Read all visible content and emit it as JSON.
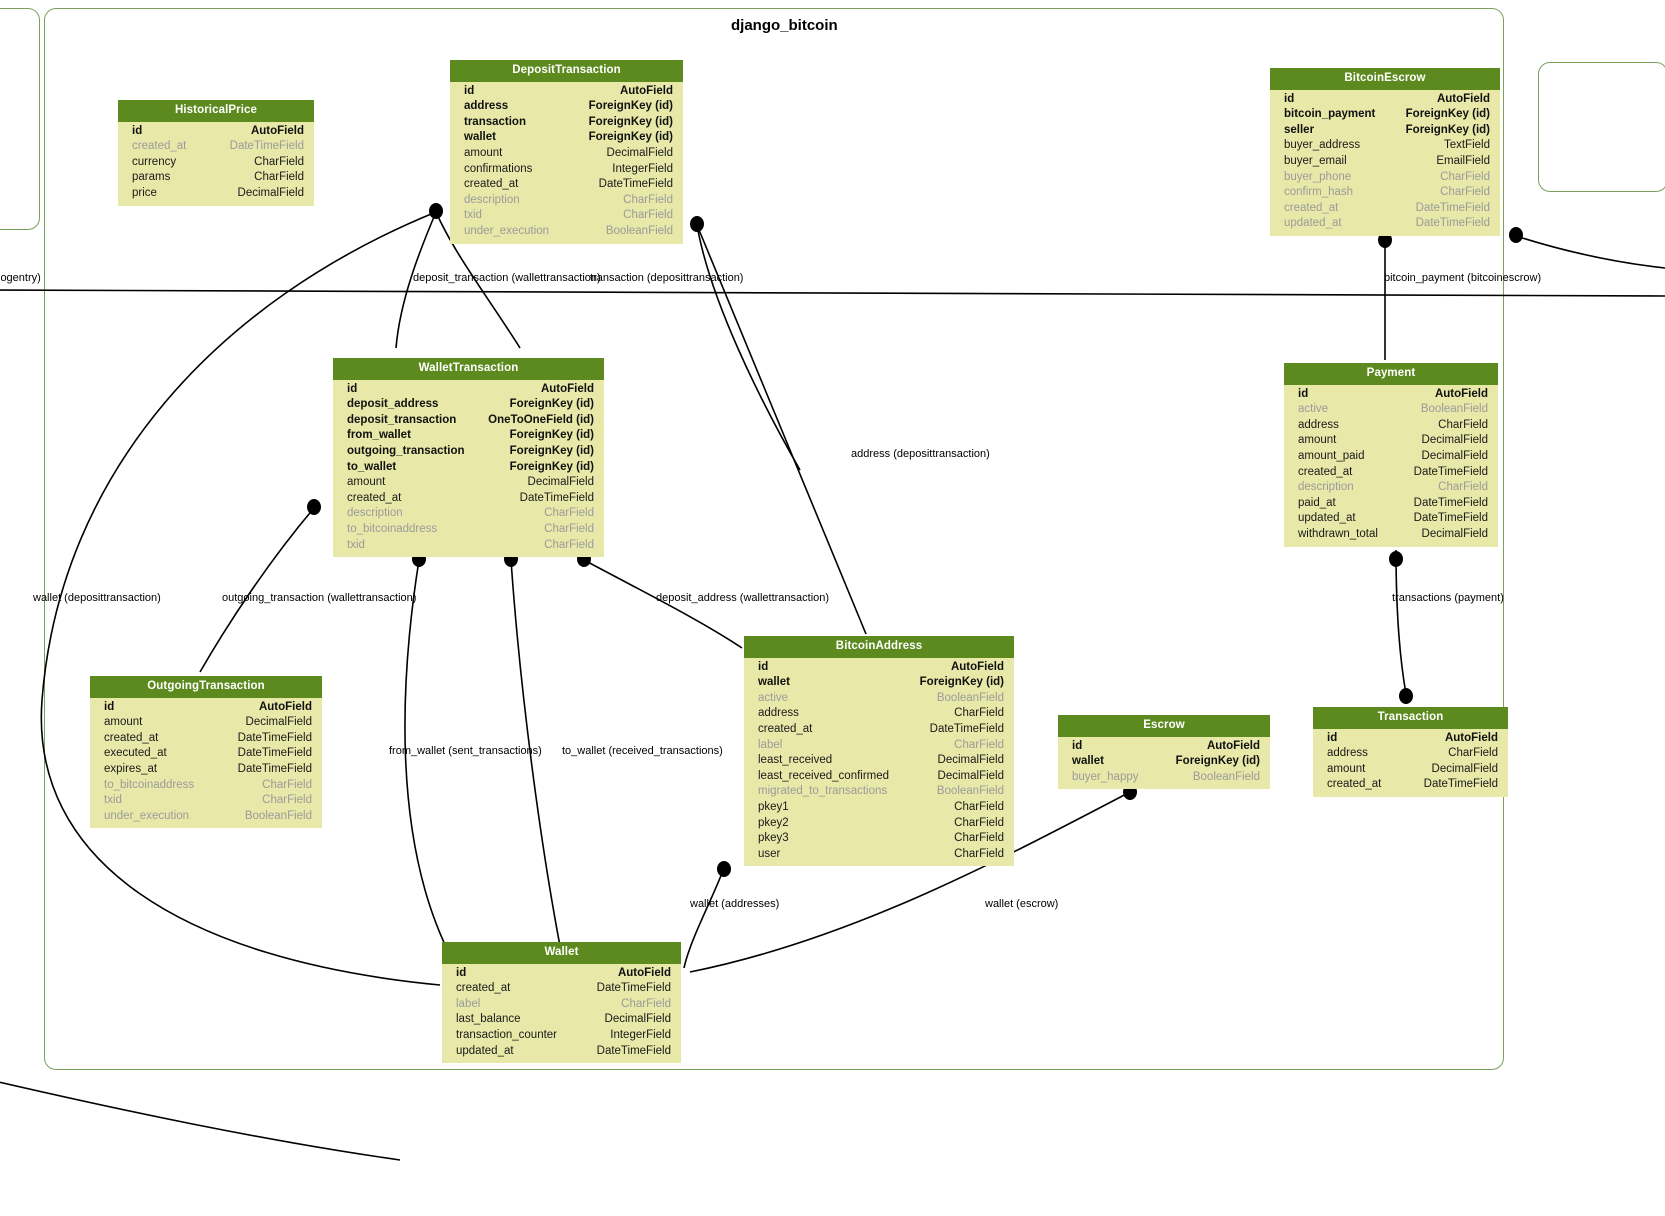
{
  "diagram": {
    "title": "django_bitcoin",
    "header_color": "#5c8a1e",
    "body_color": "#e8e8a8",
    "cluster_border_color": "#7ba05b"
  },
  "clusters": [
    {
      "name": "django_bitcoin",
      "title": "django_bitcoin"
    },
    {
      "name": "left-partial-cluster",
      "title": ""
    },
    {
      "name": "right-partial-cluster",
      "title": ""
    }
  ],
  "entities": [
    {
      "name": "HistoricalPrice",
      "title": "HistoricalPrice",
      "fields": [
        {
          "name": "id",
          "type": "AutoField",
          "style": "req"
        },
        {
          "name": "created_at",
          "type": "DateTimeField",
          "style": "dim"
        },
        {
          "name": "currency",
          "type": "CharField",
          "style": "norm"
        },
        {
          "name": "params",
          "type": "CharField",
          "style": "norm"
        },
        {
          "name": "price",
          "type": "DecimalField",
          "style": "norm"
        }
      ]
    },
    {
      "name": "DepositTransaction",
      "title": "DepositTransaction",
      "fields": [
        {
          "name": "id",
          "type": "AutoField",
          "style": "req"
        },
        {
          "name": "address",
          "type": "ForeignKey (id)",
          "style": "req"
        },
        {
          "name": "transaction",
          "type": "ForeignKey (id)",
          "style": "req"
        },
        {
          "name": "wallet",
          "type": "ForeignKey (id)",
          "style": "req"
        },
        {
          "name": "amount",
          "type": "DecimalField",
          "style": "norm"
        },
        {
          "name": "confirmations",
          "type": "IntegerField",
          "style": "norm"
        },
        {
          "name": "created_at",
          "type": "DateTimeField",
          "style": "norm"
        },
        {
          "name": "description",
          "type": "CharField",
          "style": "dim"
        },
        {
          "name": "txid",
          "type": "CharField",
          "style": "dim"
        },
        {
          "name": "under_execution",
          "type": "BooleanField",
          "style": "dim"
        }
      ]
    },
    {
      "name": "BitcoinEscrow",
      "title": "BitcoinEscrow",
      "fields": [
        {
          "name": "id",
          "type": "AutoField",
          "style": "req"
        },
        {
          "name": "bitcoin_payment",
          "type": "ForeignKey (id)",
          "style": "req"
        },
        {
          "name": "seller",
          "type": "ForeignKey (id)",
          "style": "req"
        },
        {
          "name": "buyer_address",
          "type": "TextField",
          "style": "norm"
        },
        {
          "name": "buyer_email",
          "type": "EmailField",
          "style": "norm"
        },
        {
          "name": "buyer_phone",
          "type": "CharField",
          "style": "dim"
        },
        {
          "name": "confirm_hash",
          "type": "CharField",
          "style": "dim"
        },
        {
          "name": "created_at",
          "type": "DateTimeField",
          "style": "dim"
        },
        {
          "name": "updated_at",
          "type": "DateTimeField",
          "style": "dim"
        }
      ]
    },
    {
      "name": "WalletTransaction",
      "title": "WalletTransaction",
      "fields": [
        {
          "name": "id",
          "type": "AutoField",
          "style": "req"
        },
        {
          "name": "deposit_address",
          "type": "ForeignKey (id)",
          "style": "req"
        },
        {
          "name": "deposit_transaction",
          "type": "OneToOneField (id)",
          "style": "req"
        },
        {
          "name": "from_wallet",
          "type": "ForeignKey (id)",
          "style": "req"
        },
        {
          "name": "outgoing_transaction",
          "type": "ForeignKey (id)",
          "style": "req"
        },
        {
          "name": "to_wallet",
          "type": "ForeignKey (id)",
          "style": "req"
        },
        {
          "name": "amount",
          "type": "DecimalField",
          "style": "norm"
        },
        {
          "name": "created_at",
          "type": "DateTimeField",
          "style": "norm"
        },
        {
          "name": "description",
          "type": "CharField",
          "style": "dim"
        },
        {
          "name": "to_bitcoinaddress",
          "type": "CharField",
          "style": "dim"
        },
        {
          "name": "txid",
          "type": "CharField",
          "style": "dim"
        }
      ]
    },
    {
      "name": "Payment",
      "title": "Payment",
      "fields": [
        {
          "name": "id",
          "type": "AutoField",
          "style": "req"
        },
        {
          "name": "active",
          "type": "BooleanField",
          "style": "dim"
        },
        {
          "name": "address",
          "type": "CharField",
          "style": "norm"
        },
        {
          "name": "amount",
          "type": "DecimalField",
          "style": "norm"
        },
        {
          "name": "amount_paid",
          "type": "DecimalField",
          "style": "norm"
        },
        {
          "name": "created_at",
          "type": "DateTimeField",
          "style": "norm"
        },
        {
          "name": "description",
          "type": "CharField",
          "style": "dim"
        },
        {
          "name": "paid_at",
          "type": "DateTimeField",
          "style": "norm"
        },
        {
          "name": "updated_at",
          "type": "DateTimeField",
          "style": "norm"
        },
        {
          "name": "withdrawn_total",
          "type": "DecimalField",
          "style": "norm"
        }
      ]
    },
    {
      "name": "OutgoingTransaction",
      "title": "OutgoingTransaction",
      "fields": [
        {
          "name": "id",
          "type": "AutoField",
          "style": "req"
        },
        {
          "name": "amount",
          "type": "DecimalField",
          "style": "norm"
        },
        {
          "name": "created_at",
          "type": "DateTimeField",
          "style": "norm"
        },
        {
          "name": "executed_at",
          "type": "DateTimeField",
          "style": "norm"
        },
        {
          "name": "expires_at",
          "type": "DateTimeField",
          "style": "norm"
        },
        {
          "name": "to_bitcoinaddress",
          "type": "CharField",
          "style": "dim"
        },
        {
          "name": "txid",
          "type": "CharField",
          "style": "dim"
        },
        {
          "name": "under_execution",
          "type": "BooleanField",
          "style": "dim"
        }
      ]
    },
    {
      "name": "BitcoinAddress",
      "title": "BitcoinAddress",
      "fields": [
        {
          "name": "id",
          "type": "AutoField",
          "style": "req"
        },
        {
          "name": "wallet",
          "type": "ForeignKey (id)",
          "style": "req"
        },
        {
          "name": "active",
          "type": "BooleanField",
          "style": "dim"
        },
        {
          "name": "address",
          "type": "CharField",
          "style": "norm"
        },
        {
          "name": "created_at",
          "type": "DateTimeField",
          "style": "norm"
        },
        {
          "name": "label",
          "type": "CharField",
          "style": "dim"
        },
        {
          "name": "least_received",
          "type": "DecimalField",
          "style": "norm"
        },
        {
          "name": "least_received_confirmed",
          "type": "DecimalField",
          "style": "norm"
        },
        {
          "name": "migrated_to_transactions",
          "type": "BooleanField",
          "style": "dim"
        },
        {
          "name": "pkey1",
          "type": "CharField",
          "style": "norm"
        },
        {
          "name": "pkey2",
          "type": "CharField",
          "style": "norm"
        },
        {
          "name": "pkey3",
          "type": "CharField",
          "style": "norm"
        },
        {
          "name": "user",
          "type": "CharField",
          "style": "norm"
        }
      ]
    },
    {
      "name": "Escrow",
      "title": "Escrow",
      "fields": [
        {
          "name": "id",
          "type": "AutoField",
          "style": "req"
        },
        {
          "name": "wallet",
          "type": "ForeignKey (id)",
          "style": "req"
        },
        {
          "name": "buyer_happy",
          "type": "BooleanField",
          "style": "dim"
        }
      ]
    },
    {
      "name": "Transaction",
      "title": "Transaction",
      "fields": [
        {
          "name": "id",
          "type": "AutoField",
          "style": "req"
        },
        {
          "name": "address",
          "type": "CharField",
          "style": "norm"
        },
        {
          "name": "amount",
          "type": "DecimalField",
          "style": "norm"
        },
        {
          "name": "created_at",
          "type": "DateTimeField",
          "style": "norm"
        }
      ]
    },
    {
      "name": "Wallet",
      "title": "Wallet",
      "fields": [
        {
          "name": "id",
          "type": "AutoField",
          "style": "req"
        },
        {
          "name": "created_at",
          "type": "DateTimeField",
          "style": "norm"
        },
        {
          "name": "label",
          "type": "CharField",
          "style": "dim"
        },
        {
          "name": "last_balance",
          "type": "DecimalField",
          "style": "norm"
        },
        {
          "name": "transaction_counter",
          "type": "IntegerField",
          "style": "norm"
        },
        {
          "name": "updated_at",
          "type": "DateTimeField",
          "style": "norm"
        }
      ]
    }
  ],
  "edge_labels": [
    {
      "name": "logentry",
      "text": "logentry)"
    },
    {
      "name": "deposit-transaction-wallettransaction",
      "text": "deposit_transaction (wallettransaction)"
    },
    {
      "name": "transaction-deposittransaction",
      "text": "transaction (deposittransaction)"
    },
    {
      "name": "bitcoin-payment-bitcoinescrow",
      "text": "bitcoin_payment (bitcoinescrow)"
    },
    {
      "name": "address-deposittransaction",
      "text": "address (deposittransaction)"
    },
    {
      "name": "wallet-deposittransaction",
      "text": "wallet (deposittransaction)"
    },
    {
      "name": "outgoing-transaction-wallettransaction",
      "text": "outgoing_transaction (wallettransaction)"
    },
    {
      "name": "deposit-address-wallettransaction",
      "text": "deposit_address (wallettransaction)"
    },
    {
      "name": "transactions-payment",
      "text": "transactions (payment)"
    },
    {
      "name": "from-wallet-sent-transactions",
      "text": "from_wallet (sent_transactions)"
    },
    {
      "name": "to-wallet-received-transactions",
      "text": "to_wallet (received_transactions)"
    },
    {
      "name": "wallet-addresses",
      "text": "wallet (addresses)"
    },
    {
      "name": "wallet-escrow",
      "text": "wallet (escrow)"
    }
  ]
}
